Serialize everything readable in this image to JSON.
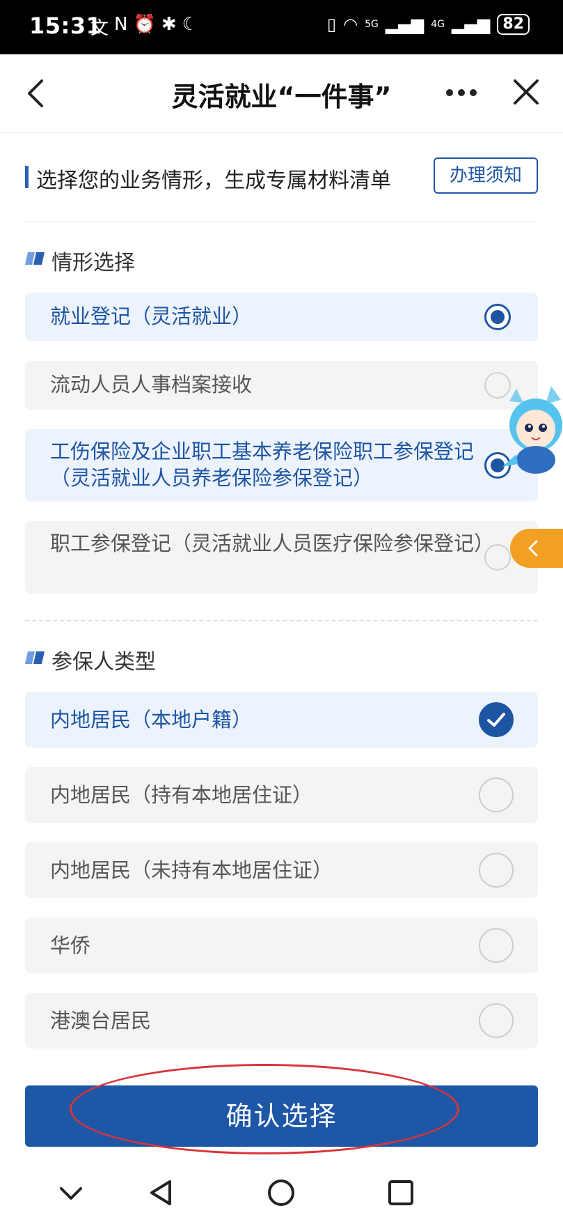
{
  "status_bar": {
    "time": "15:31",
    "battery": "82",
    "signal_labels": [
      "5G",
      "4G"
    ]
  },
  "navbar": {
    "title": "灵活就业“一件事”"
  },
  "section": {
    "title": "选择您的业务情形，生成专属材料清单",
    "notice_button": "办理须知"
  },
  "situation_group": {
    "label": "情形选择",
    "options": [
      {
        "text": "就业登记（灵活就业）",
        "selected": true
      },
      {
        "text": "流动人员人事档案接收",
        "selected": false
      },
      {
        "text": "工伤保险及企业职工基本养老保险职工参保登记（灵活就业人员养老保险参保登记）",
        "selected": true
      },
      {
        "text": "职工参保登记（灵活就业人员医疗保险参保登记）",
        "selected": false
      }
    ]
  },
  "insured_group": {
    "label": "参保人类型",
    "options": [
      {
        "text": "内地居民（本地户籍）",
        "selected": true
      },
      {
        "text": "内地居民（持有本地居住证）",
        "selected": false
      },
      {
        "text": "内地居民（未持有本地居住证）",
        "selected": false
      },
      {
        "text": "华侨",
        "selected": false
      },
      {
        "text": "港澳台居民",
        "selected": false
      }
    ]
  },
  "confirm_button": "确认选择",
  "colors": {
    "primary": "#1e57a6",
    "selected_bg": "#ecf3fd",
    "unselected_bg": "#f4f4f4",
    "accent_tab": "#f2a024",
    "annotation_red": "#d9333a"
  },
  "icons": {
    "back": "chevron-left-icon",
    "more": "more-dots-icon",
    "close": "close-icon",
    "side_tab": "chevron-left-icon",
    "check": "check-icon"
  }
}
